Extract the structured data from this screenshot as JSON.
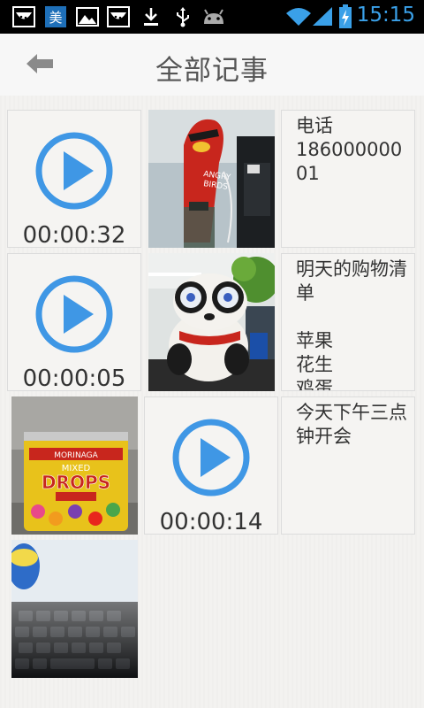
{
  "status_bar": {
    "time": "15:15",
    "notification_icons": [
      "watermelon-app-icon",
      "meituan-app-icon",
      "gallery-icon",
      "watermelon-app-icon",
      "download-icon",
      "usb-icon",
      "android-debug-icon"
    ],
    "system_icons": [
      "wifi-icon",
      "signal-icon",
      "battery-charging-icon"
    ],
    "time_color": "#3aa0e8"
  },
  "header": {
    "title": "全部记事",
    "back_icon": "back-arrow-icon"
  },
  "notes": [
    {
      "type": "audio",
      "duration": "00:00:32"
    },
    {
      "type": "photo",
      "subject": "angry-birds-plush-photo"
    },
    {
      "type": "text",
      "text": "电话\n18600000001"
    },
    {
      "type": "audio",
      "duration": "00:00:05"
    },
    {
      "type": "photo",
      "subject": "panda-doll-photo"
    },
    {
      "type": "text",
      "text": "明天的购物清单\n\n苹果\n花生\n鸡蛋"
    },
    {
      "type": "photo",
      "subject": "morinaga-drops-candy-photo"
    },
    {
      "type": "audio",
      "duration": "00:00:14"
    },
    {
      "type": "text",
      "text": "今天下午三点钟开会"
    },
    {
      "type": "photo",
      "subject": "keyboard-photo"
    }
  ],
  "colors": {
    "accent": "#3f97e5",
    "header_bg": "#f7f7f7",
    "page_bg": "#f3f2f0"
  }
}
